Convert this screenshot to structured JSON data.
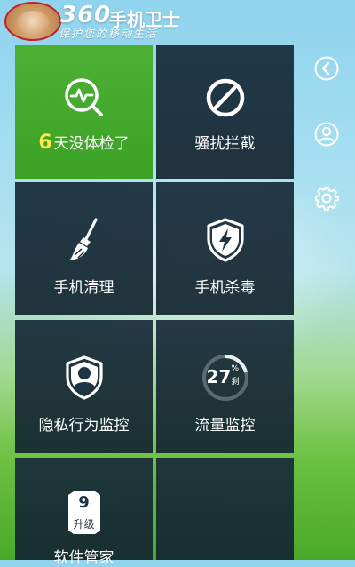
{
  "header": {
    "brand_number": "360",
    "brand_name": "手机卫士",
    "slogan": "保护您的移动生活"
  },
  "side_icons": [
    "back-circle-icon",
    "user-circle-icon",
    "gear-icon"
  ],
  "tiles": [
    {
      "name": "checkup",
      "icon": "health-check-icon",
      "highlight": "6",
      "label": "天没体检了",
      "accent": "#ffe94a"
    },
    {
      "name": "harassment-block",
      "icon": "block-icon",
      "label": "骚扰拦截"
    },
    {
      "name": "phone-cleanup",
      "icon": "broom-icon",
      "label": "手机清理"
    },
    {
      "name": "virus-scan",
      "icon": "shield-bolt-icon",
      "label": "手机杀毒"
    },
    {
      "name": "privacy-monitor",
      "icon": "shield-person-icon",
      "label": "隐私行为监控"
    },
    {
      "name": "traffic-monitor",
      "icon": "traffic-ring-icon",
      "label": "流量监控",
      "gauge_value": "27",
      "gauge_unit": "%",
      "gauge_sub": "剩"
    },
    {
      "name": "software-manager",
      "icon": "upgrade-badge-icon",
      "label": "软件管家",
      "badge_count": "9",
      "badge_text": "升级"
    },
    {
      "name": "empty-tile",
      "label": ""
    }
  ],
  "colors": {
    "accent_green": "#3ba226",
    "tile_dark": "#182c3a",
    "highlight_yellow": "#ffe94a",
    "avatar_ring": "#c81e2a"
  }
}
